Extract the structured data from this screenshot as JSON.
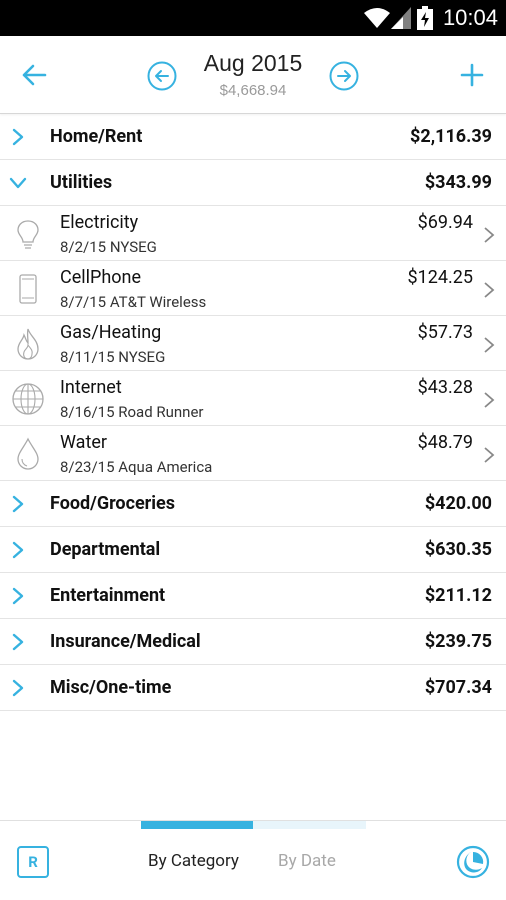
{
  "status_bar": {
    "time": "10:04"
  },
  "header": {
    "month": "Aug 2015",
    "total": "$4,668.94"
  },
  "categories": [
    {
      "name": "Home/Rent",
      "amount": "$2,116.39"
    },
    {
      "name": "Utilities",
      "amount": "$343.99",
      "expanded": true
    },
    {
      "name": "Food/Groceries",
      "amount": "$420.00"
    },
    {
      "name": "Departmental",
      "amount": "$630.35"
    },
    {
      "name": "Entertainment",
      "amount": "$211.12"
    },
    {
      "name": "Insurance/Medical",
      "amount": "$239.75"
    },
    {
      "name": "Misc/One-time",
      "amount": "$707.34"
    }
  ],
  "utility_items": [
    {
      "name": "Electricity",
      "detail": "8/2/15 NYSEG",
      "amount": "$69.94",
      "icon": "lightbulb-icon"
    },
    {
      "name": "CellPhone",
      "detail": "8/7/15 AT&T Wireless",
      "amount": "$124.25",
      "icon": "phone-icon"
    },
    {
      "name": "Gas/Heating",
      "detail": "8/11/15 NYSEG",
      "amount": "$57.73",
      "icon": "flame-icon"
    },
    {
      "name": "Internet",
      "detail": "8/16/15 Road Runner",
      "amount": "$43.28",
      "icon": "globe-icon"
    },
    {
      "name": "Water",
      "detail": "8/23/15 Aqua America",
      "amount": "$48.79",
      "icon": "water-drop-icon"
    }
  ],
  "bottom_bar": {
    "r_label": "R",
    "tab_category": "By Category",
    "tab_date": "By Date",
    "active_tab": "By Category"
  },
  "colors": {
    "accent": "#36b2e0",
    "text": "#111111",
    "muted": "#9a9a9a"
  }
}
